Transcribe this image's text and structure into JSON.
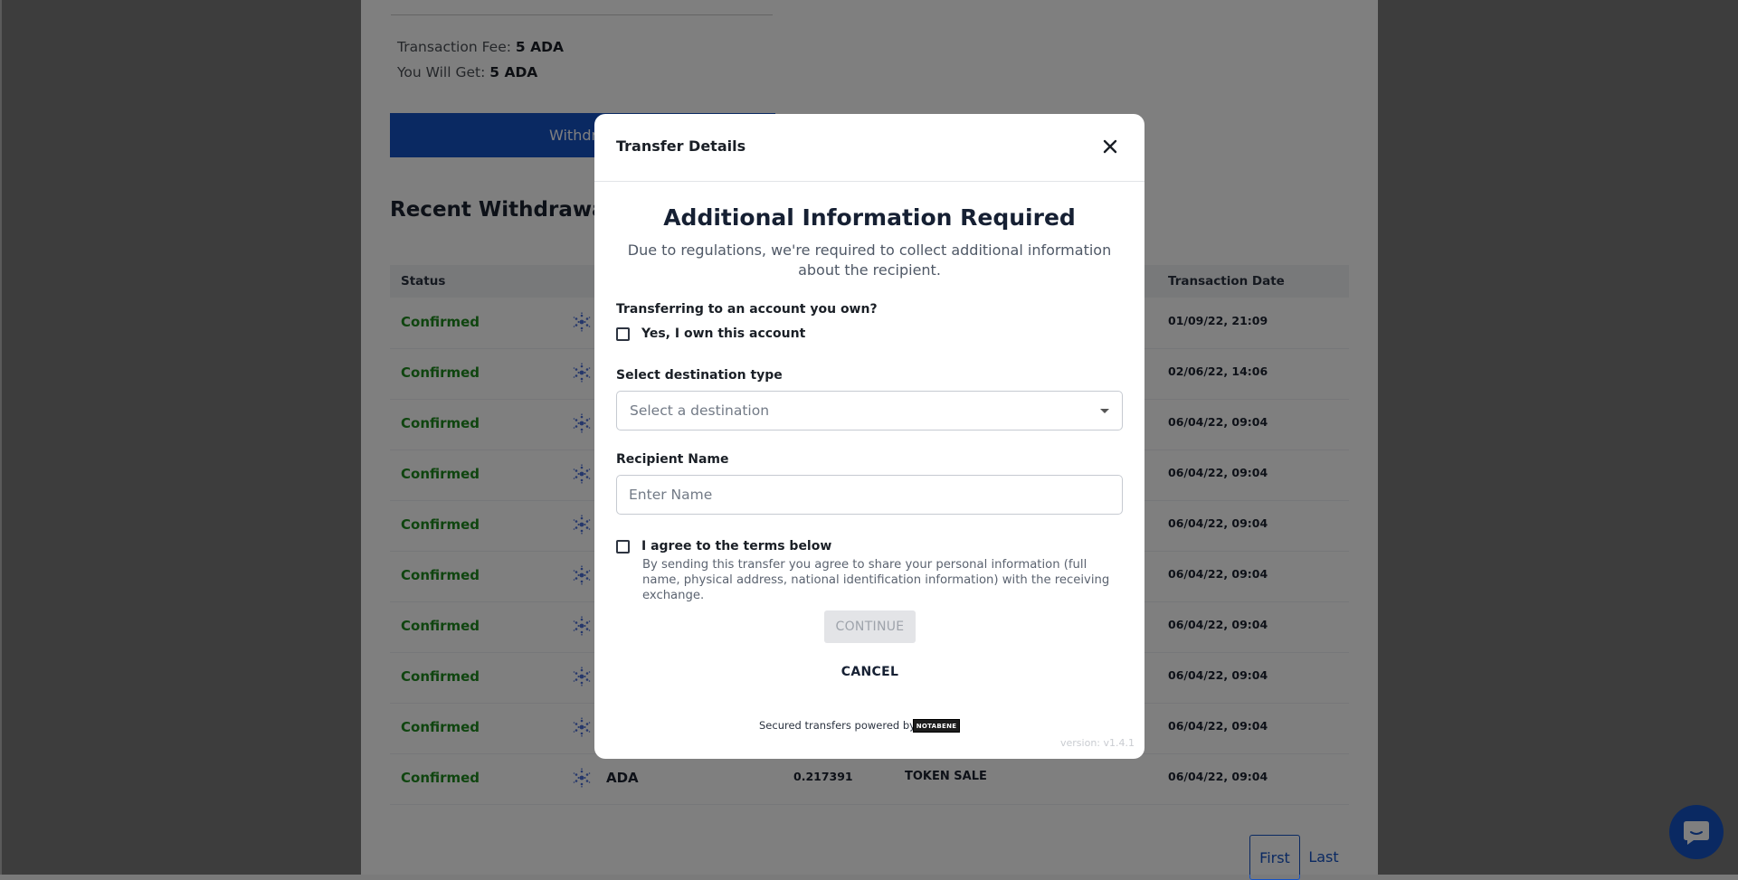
{
  "background": {
    "fee": {
      "label": "Transaction Fee:",
      "value": "5 ADA"
    },
    "you_get": {
      "label": "You Will Get:",
      "value": "5 ADA"
    },
    "withdraw_button": "Withdr",
    "history_title": "Recent Withdrawal H",
    "table": {
      "headers": {
        "status": "Status",
        "date": "Transaction Date"
      },
      "rows": [
        {
          "status": "Confirmed",
          "date": "01/09/22, 21:09"
        },
        {
          "status": "Confirmed",
          "date": "02/06/22, 14:06"
        },
        {
          "status": "Confirmed",
          "date": "06/04/22, 09:04"
        },
        {
          "status": "Confirmed",
          "date": "06/04/22, 09:04"
        },
        {
          "status": "Confirmed",
          "date": "06/04/22, 09:04"
        },
        {
          "status": "Confirmed",
          "date": "06/04/22, 09:04"
        },
        {
          "status": "Confirmed",
          "date": "06/04/22, 09:04"
        },
        {
          "status": "Confirmed",
          "date": "06/04/22, 09:04"
        },
        {
          "status": "Confirmed",
          "date": "06/04/22, 09:04"
        },
        {
          "status": "Confirmed",
          "asset": "ADA",
          "amount": "0.217391",
          "type": "TOKEN SALE",
          "date": "06/04/22, 09:04"
        }
      ]
    },
    "pagination": {
      "first": "First",
      "last": "Last"
    },
    "icons": {
      "coin": "cardano-icon",
      "chat": "chat-icon"
    }
  },
  "modal": {
    "title": "Transfer Details",
    "heading": "Additional Information Required",
    "subtitle": "Due to regulations, we're required to collect additional information about the recipient.",
    "own_account": {
      "question": "Transferring to an account you own?",
      "checkbox_label": "Yes, I own this account",
      "checked": false
    },
    "destination": {
      "label": "Select destination type",
      "placeholder": "Select a destination"
    },
    "recipient": {
      "label": "Recipient Name",
      "placeholder": "Enter Name",
      "value": ""
    },
    "terms": {
      "checkbox_label": "I agree to the terms below",
      "text": "By sending this transfer you agree to share your personal information (full name, physical address, national identification information) with the receiving exchange.",
      "checked": false
    },
    "continue_label": "CONTINUE",
    "cancel_label": "CANCEL",
    "powered_by": "Secured transfers powered by",
    "logo_text": "NOTABENE",
    "version": "version: v1.4.1"
  },
  "colors": {
    "accent": "#1552c4",
    "status_confirmed": "#1f8a1f",
    "overlay": "rgba(0,0,0,0.5)"
  }
}
